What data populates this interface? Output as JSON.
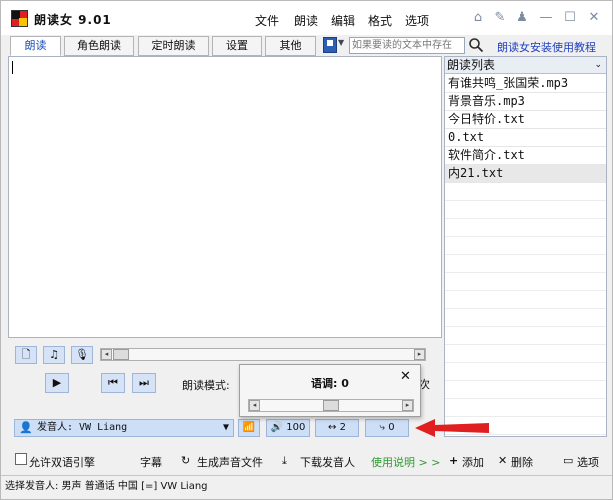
{
  "app": {
    "title": "朗读女 9.01"
  },
  "menu": [
    "文件",
    "朗读",
    "编辑",
    "格式",
    "选项"
  ],
  "tabs": [
    "朗读",
    "角色朗读",
    "定时朗读",
    "设置",
    "其他"
  ],
  "search": {
    "placeholder": "如果要读的文本中存在"
  },
  "help_link": "朗读女安装使用教程",
  "playlist": {
    "header": "朗读列表",
    "items": [
      "有谁共鸣_张国荣.mp3",
      "背景音乐.mp3",
      "今日特价.txt",
      "0.txt",
      "软件简介.txt",
      "内21.txt"
    ],
    "selected_index": 5
  },
  "controls": {
    "mode_label": "朗读模式:",
    "mode_partial": "次",
    "speaker_label": "发音人: VW Liang",
    "volume": "100",
    "speed": "2",
    "pitch": "0"
  },
  "popup": {
    "title": "语调: 0"
  },
  "bottom": {
    "allow_dual": "允许双语引擎",
    "subtitles": "字幕",
    "generate_audio": "生成声音文件",
    "download_voice": "下载发音人",
    "usage_help": "使用说明 > >",
    "add": "添加",
    "delete": "删除",
    "options": "选项"
  },
  "status": "选择发音人: 男声  普通话  中国  [=]  VW Liang",
  "colors": {
    "accent": "#1c4fb8",
    "green": "#2f9a2f",
    "arrow": "#e02020"
  }
}
